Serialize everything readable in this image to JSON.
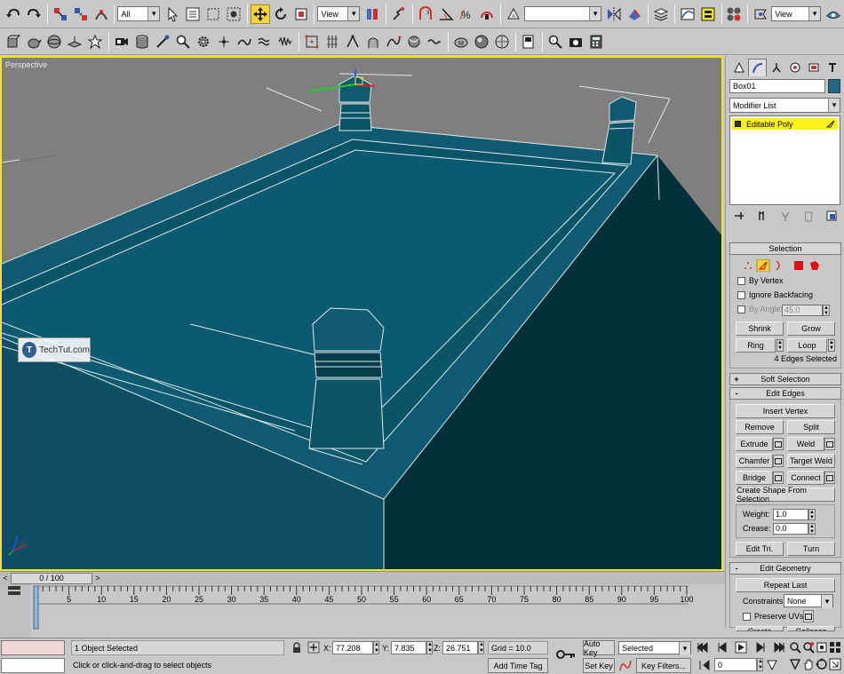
{
  "toolbar": {
    "selection_filter": "All",
    "ref_coord_1": "View",
    "named_selection": "",
    "ref_coord_2": "View",
    "icons": [
      "undo-icon",
      "redo-icon",
      "select-link-icon",
      "unlink-icon",
      "bind-spacewarp-icon",
      "select-object-icon",
      "select-by-name-icon",
      "rect-region-icon",
      "window-crossing-icon",
      "select-move-icon",
      "select-rotate-icon",
      "select-scale-icon",
      "pivot-icon",
      "manipulate-icon",
      "snap-3d-icon",
      "angle-snap-icon",
      "percent-snap-icon",
      "spinner-snap-icon",
      "edit-named-sel-icon",
      "mirror-icon",
      "align-icon",
      "layer-manager-icon",
      "curve-editor-icon",
      "schematic-icon",
      "material-editor-icon",
      "render-scene-icon",
      "quick-render-icon"
    ]
  },
  "toolbar2": {
    "icons": [
      "box-icon",
      "teapot-icon",
      "sphere-icon",
      "plane-icon",
      "light-icon",
      "camera-icon",
      "cylinder-icon",
      "paint-icon",
      "magnifier-icon",
      "gear-icon",
      "bend-icon",
      "twist-icon",
      "wave-icon",
      "noise-icon",
      "ffd-icon",
      "lattice-icon",
      "bone-icon",
      "skin-icon",
      "path-icon",
      "morph-icon",
      "unwrap-icon",
      "material-icon",
      "smooth-icon",
      "mesh-icon",
      "zoom-icon",
      "render-frame-icon",
      "calculator-icon"
    ]
  },
  "viewport": {
    "label": "Perspective",
    "watermark": "TechTut.com",
    "watermark_logo": "T"
  },
  "command_panel": {
    "tabs": [
      "create-tab",
      "modify-tab",
      "hierarchy-tab",
      "motion-tab",
      "display-tab",
      "utilities-tab"
    ],
    "object_name": "Box01",
    "object_color": "#1d6a82",
    "modifier_list": "Modifier List",
    "stack_item": "Editable Poly",
    "selection": {
      "title": "Selection",
      "by_vertex": "By Vertex",
      "ignore_backfacing": "Ignore Backfacing",
      "by_angle": "By Angle:",
      "by_angle_value": "45.0",
      "shrink": "Shrink",
      "grow": "Grow",
      "ring": "Ring",
      "loop": "Loop",
      "status": "4 Edges Selected"
    },
    "soft_selection": {
      "title": "Soft Selection",
      "sign": "+"
    },
    "edit_edges": {
      "title": "Edit Edges",
      "sign": "-",
      "insert_vertex": "Insert Vertex",
      "remove": "Remove",
      "split": "Split",
      "extrude": "Extrude",
      "weld": "Weld",
      "chamfer": "Chamfer",
      "target_weld": "Target Weld",
      "bridge": "Bridge",
      "connect": "Connect",
      "create_shape": "Create Shape From Selection",
      "weight_label": "Weight:",
      "weight_value": "1.0",
      "crease_label": "Crease:",
      "crease_value": "0.0",
      "edit_tri": "Edit Tri.",
      "turn": "Turn"
    },
    "edit_geometry": {
      "title": "Edit Geometry",
      "sign": "-",
      "repeat_last": "Repeat Last",
      "constraints_label": "Constraints:",
      "constraints_value": "None",
      "preserve_uvs": "Preserve UVs",
      "create": "Create",
      "collapse": "Collapse"
    }
  },
  "timeline": {
    "frame_display": "0 / 100",
    "prev": "<",
    "next": ">",
    "ticks": [
      "0",
      "5",
      "10",
      "15",
      "20",
      "25",
      "30",
      "35",
      "40",
      "45",
      "50",
      "55",
      "60",
      "65",
      "70",
      "75",
      "80",
      "85",
      "90",
      "95",
      "100"
    ]
  },
  "status": {
    "objects_selected": "1 Object Selected",
    "prompt": "Click or click-and-drag to select objects",
    "x_label": "X:",
    "x_value": "77.208",
    "y_label": "Y:",
    "y_value": "7.835",
    "z_label": "Z:",
    "z_value": "26.751",
    "grid": "Grid = 10.0",
    "add_time_tag": "Add Time Tag",
    "auto_key": "Auto Key",
    "set_key": "Set Key",
    "key_mode_value": "Selected",
    "key_filters": "Key Filters...",
    "current_frame": "0"
  }
}
